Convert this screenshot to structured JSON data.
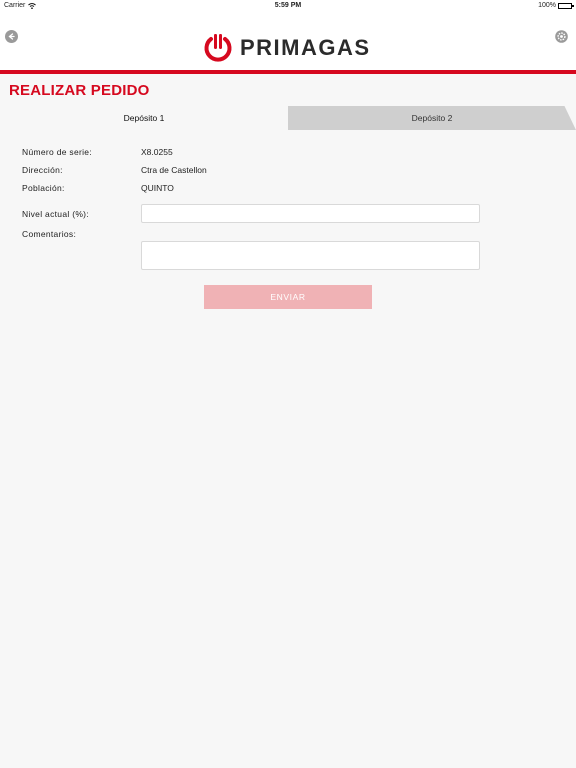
{
  "statusbar": {
    "carrier": "Carrier",
    "time": "5:59 PM",
    "battery": "100%"
  },
  "header": {
    "logo_text": "PRIMAGAS"
  },
  "page": {
    "title": "REALIZAR PEDIDO"
  },
  "tabs": [
    {
      "label": "Depósito 1",
      "active": true
    },
    {
      "label": "Depósito 2",
      "active": false
    }
  ],
  "form": {
    "serial_label": "Número de serie:",
    "serial_value": "X8.0255",
    "address_label": "Dirección:",
    "address_value": "Ctra de Castellon",
    "town_label": "Población:",
    "town_value": "QUINTO",
    "level_label": "Nivel actual (%):",
    "level_value": "",
    "comments_label": "Comentarios:",
    "comments_value": "",
    "submit_label": "ENVIAR"
  },
  "colors": {
    "brand_red": "#d6091f",
    "button_disabled": "#f0b2b5"
  },
  "icons": [
    "back-icon",
    "settings-icon",
    "wifi-icon",
    "battery-icon",
    "primagas-power-icon"
  ]
}
